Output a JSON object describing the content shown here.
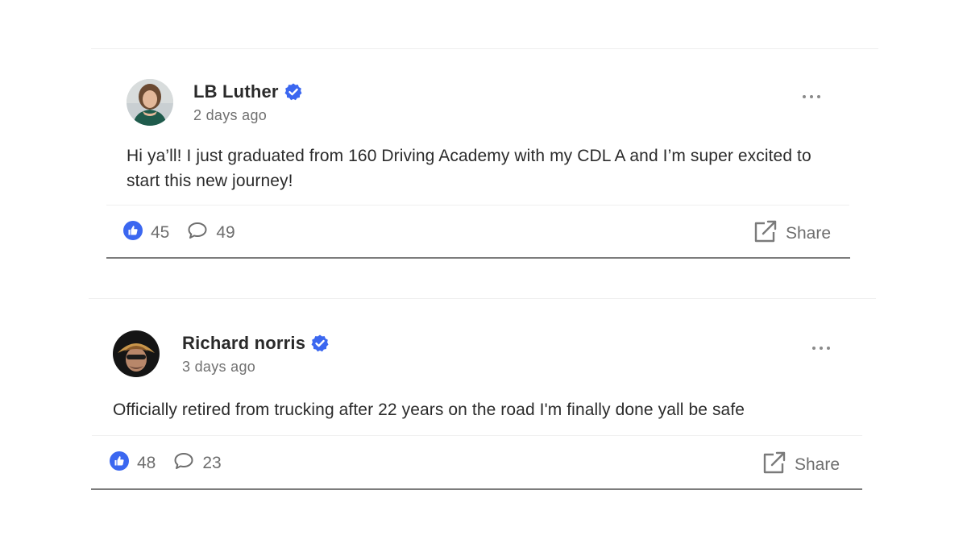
{
  "posts": [
    {
      "author": "LB Luther",
      "time": "2 days ago",
      "text": "Hi ya’ll! I just graduated from 160 Driving Academy with my CDL A and I’m super excited to start this new journey!",
      "likes": "45",
      "comments": "49",
      "share_label": "Share"
    },
    {
      "author": "Richard norris",
      "time": "3 days ago",
      "text": "Officially retired from trucking after 22 years on the road I'm finally done yall be safe",
      "likes": "48",
      "comments": "23",
      "share_label": "Share"
    }
  ],
  "colors": {
    "accent": "#3b67f0",
    "text": "#2b2b2b",
    "muted": "#6e6e6e"
  },
  "icons": {
    "verified": "verified-badge-icon",
    "like": "thumbs-up-icon",
    "comment": "comment-bubble-icon",
    "share": "external-share-icon",
    "more": "more-options-icon"
  }
}
